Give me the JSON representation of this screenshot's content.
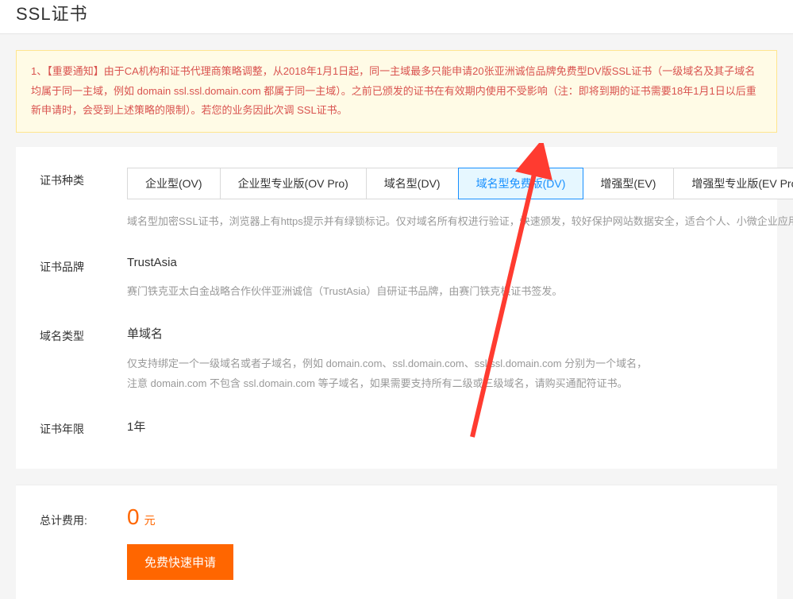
{
  "header": {
    "title": "SSL证书"
  },
  "notice": {
    "text": "1、【重要通知】由于CA机构和证书代理商策略调整，从2018年1月1日起，同一主域最多只能申请20张亚洲诚信品牌免费型DV版SSL证书（一级域名及其子域名均属于同一主域，例如 domain ssl.ssl.domain.com 都属于同一主域）。之前已颁发的证书在有效期内使用不受影响（注：即将到期的证书需要18年1月1日以后重新申请时，会受到上述策略的限制）。若您的业务因此次调 SSL证书。"
  },
  "certType": {
    "label": "证书种类",
    "tabs": {
      "ov": "企业型(OV)",
      "ovpro": "企业型专业版(OV Pro)",
      "dv": "域名型(DV)",
      "dvfree": "域名型免费版(DV)",
      "ev": "增强型(EV)",
      "evpro": "增强型专业版(EV Pro)"
    },
    "desc": "域名型加密SSL证书，浏览器上有https提示并有绿锁标记。仅对域名所有权进行验证，快速颁发，较好保护网站数据安全，适合个人、小微企业应用。"
  },
  "brand": {
    "label": "证书品牌",
    "value": "TrustAsia",
    "desc": "赛门铁克亚太白金战略合作伙伴亚洲诚信（TrustAsia）自研证书品牌，由赛门铁克根证书签发。"
  },
  "domainType": {
    "label": "域名类型",
    "value": "单域名",
    "desc1": "仅支持绑定一个一级域名或者子域名，例如 domain.com、ssl.domain.com、ssl.ssl.domain.com 分别为一个域名，",
    "desc2": "注意 domain.com 不包含 ssl.domain.com 等子域名，如果需要支持所有二级或三级域名，请购买通配符证书。"
  },
  "year": {
    "label": "证书年限",
    "value": "1年"
  },
  "cost": {
    "label": "总计费用:",
    "value": "0",
    "unit": "元"
  },
  "applyButton": "免费快速申请"
}
